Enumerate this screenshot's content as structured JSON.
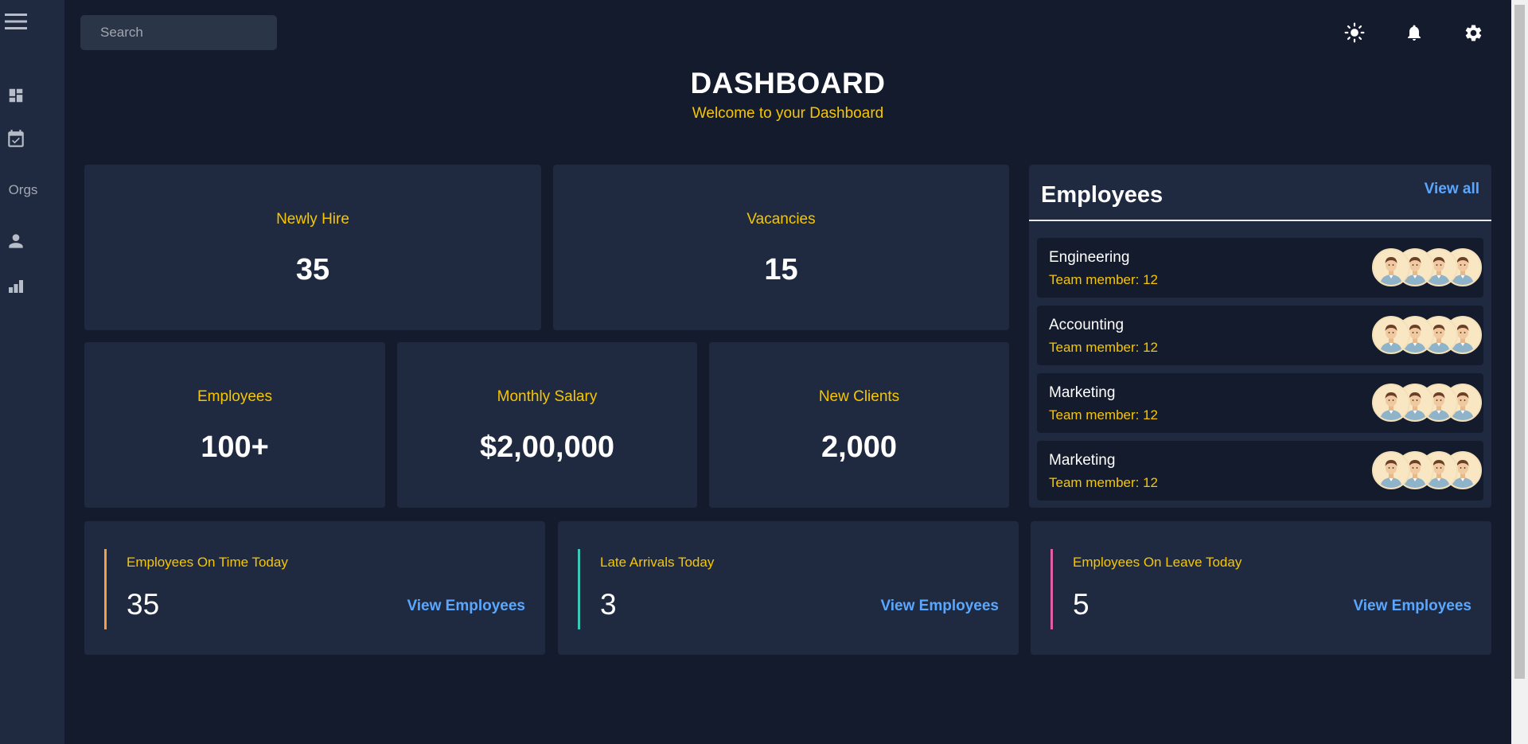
{
  "search": {
    "placeholder": "Search"
  },
  "sidebar": {
    "orgs_label": "Orgs"
  },
  "header": {
    "title": "DASHBOARD",
    "subtitle": "Welcome to your Dashboard"
  },
  "stats": {
    "newly_hire": {
      "label": "Newly Hire",
      "value": "35"
    },
    "vacancies": {
      "label": "Vacancies",
      "value": "15"
    },
    "employees": {
      "label": "Employees",
      "value": "100+"
    },
    "monthly_salary": {
      "label": "Monthly Salary",
      "value": "$2,00,000"
    },
    "new_clients": {
      "label": "New Clients",
      "value": "2,000"
    }
  },
  "employees_panel": {
    "title": "Employees",
    "view_all": "View all",
    "departments": [
      {
        "name": "Engineering",
        "members": "Team member: 12"
      },
      {
        "name": "Accounting",
        "members": "Team member: 12"
      },
      {
        "name": "Marketing",
        "members": "Team member: 12"
      },
      {
        "name": "Marketing",
        "members": "Team member: 12"
      }
    ]
  },
  "attendance": [
    {
      "label": "Employees On Time Today",
      "value": "35",
      "link": "View Employees",
      "accent": "#f59e42"
    },
    {
      "label": "Late Arrivals Today",
      "value": "3",
      "link": "View Employees",
      "accent": "#3cc6b5"
    },
    {
      "label": "Employees On Leave Today",
      "value": "5",
      "link": "View Employees",
      "accent": "#e05fa0"
    }
  ],
  "colors": {
    "background": "#141b2d",
    "panel": "#1f2a40",
    "accent_yellow": "#f7c600",
    "link_blue": "#5aa7ff"
  }
}
